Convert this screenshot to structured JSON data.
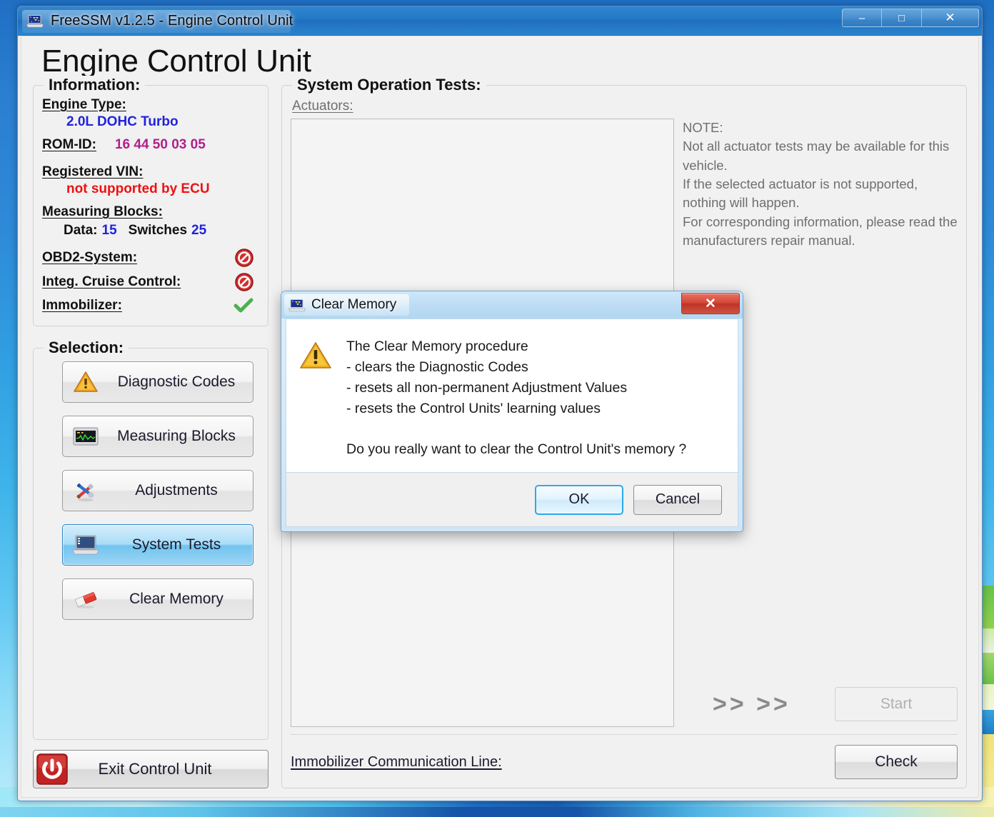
{
  "window": {
    "title": "FreeSSM v1.2.5 - Engine Control Unit",
    "icon": "freessm-laptop-icon",
    "minimize_label": "–",
    "maximize_label": "□",
    "close_label": "✕"
  },
  "page": {
    "title": "Engine Control Unit"
  },
  "information": {
    "legend": "Information:",
    "engine_type_label": "Engine Type:",
    "engine_type_value": "2.0L DOHC Turbo",
    "rom_id_label": "ROM-ID:",
    "rom_id_value": "16 44 50 03 05",
    "registered_vin_label": "Registered VIN:",
    "registered_vin_value": "not supported by ECU",
    "measuring_blocks_label": "Measuring Blocks:",
    "data_label": "Data:",
    "data_value": "15",
    "switches_label": "Switches",
    "switches_value": "25",
    "obd2_label": "OBD2-System:",
    "obd2_status": "not-supported",
    "cruise_label": "Integ. Cruise Control:",
    "cruise_status": "not-supported",
    "immobilizer_label": "Immobilizer:",
    "immobilizer_status": "supported",
    "colors": {
      "value_blue": "#2222dd",
      "value_purple": "#b0208a",
      "value_red": "#ee1111",
      "status_red": "#cc2222",
      "status_green": "#4caf50"
    }
  },
  "selection": {
    "legend": "Selection:",
    "items": [
      {
        "label": "Diagnostic Codes",
        "icon": "warning-triangle-icon",
        "active": false
      },
      {
        "label": "Measuring Blocks",
        "icon": "oscilloscope-icon",
        "active": false
      },
      {
        "label": "Adjustments",
        "icon": "tools-icon",
        "active": false
      },
      {
        "label": "System Tests",
        "icon": "laptop-icon",
        "active": true
      },
      {
        "label": "Clear Memory",
        "icon": "eraser-icon",
        "active": false
      }
    ],
    "exit_label": "Exit Control Unit",
    "exit_icon": "power-icon"
  },
  "system_tests": {
    "legend": "System Operation Tests:",
    "actuators_label": "Actuators:",
    "actuators_items": [],
    "note": "NOTE:\nNot all actuator tests may be available for this vehicle.\nIf the selected actuator is not supported, nothing will happen.\nFor corresponding information, please read the manufacturers repair manual.",
    "chevrons": ">> >>",
    "start_label": "Start",
    "start_enabled": false
  },
  "bottom": {
    "immobilizer_line_label": "Immobilizer Communication Line:",
    "check_label": "Check"
  },
  "dialog": {
    "title": "Clear Memory",
    "icon": "freessm-laptop-icon",
    "close_label": "✕",
    "warning_icon": "warning-triangle-icon",
    "message": "The Clear Memory procedure\n- clears the Diagnostic Codes\n- resets all non-permanent Adjustment Values\n- resets the Control Units' learning values\n\nDo you really want to clear the Control Unit's memory ?",
    "ok_label": "OK",
    "cancel_label": "Cancel"
  }
}
